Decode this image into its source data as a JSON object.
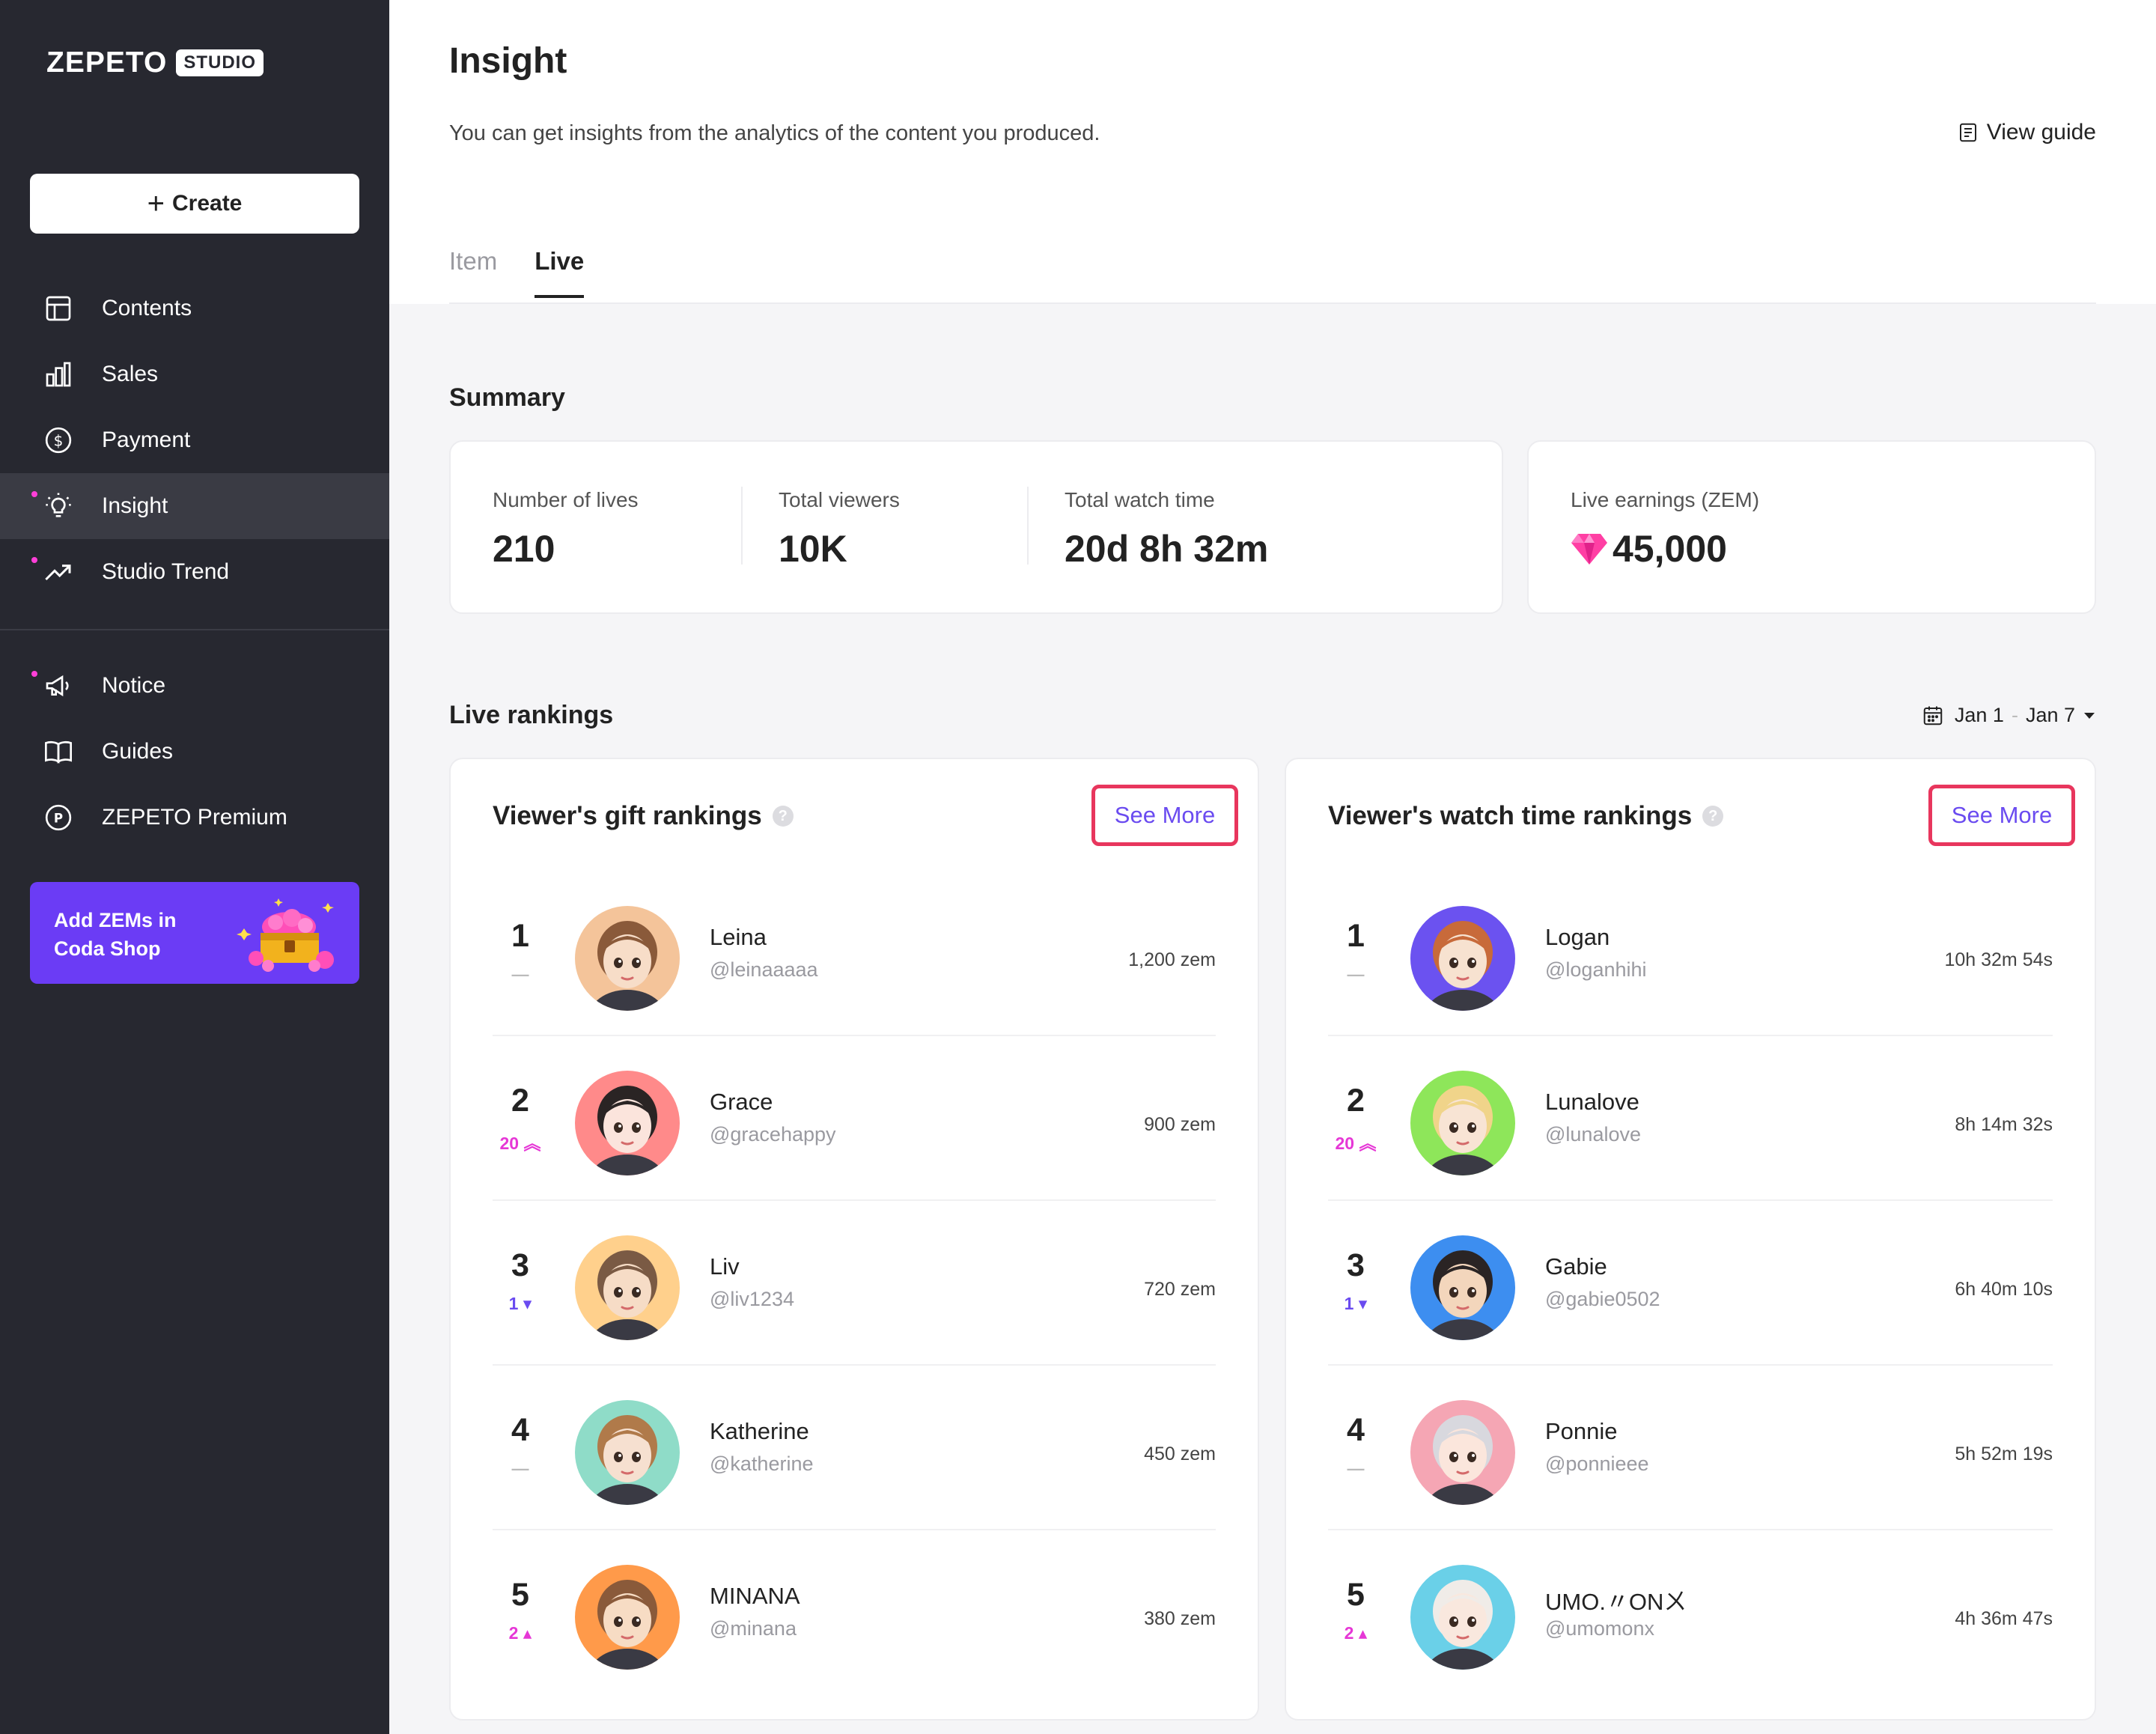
{
  "sidebar": {
    "logo_word": "ZEPETO",
    "logo_badge": "STUDIO",
    "create_label": "Create",
    "nav": [
      {
        "label": "Contents",
        "icon": "layout-icon"
      },
      {
        "label": "Sales",
        "icon": "bar-chart-icon"
      },
      {
        "label": "Payment",
        "icon": "dollar-circle-icon"
      },
      {
        "label": "Insight",
        "icon": "lightbulb-icon"
      },
      {
        "label": "Studio Trend",
        "icon": "trend-icon"
      }
    ],
    "nav2": [
      {
        "label": "Notice",
        "icon": "megaphone-icon"
      },
      {
        "label": "Guides",
        "icon": "book-icon"
      },
      {
        "label": "ZEPETO Premium",
        "icon": "premium-icon"
      }
    ],
    "promo_line1": "Add ZEMs in",
    "promo_line2": "Coda Shop"
  },
  "header": {
    "title": "Insight",
    "subtitle": "You can get insights from the analytics of the content you produced.",
    "view_guide": "View guide",
    "tabs": [
      "Item",
      "Live"
    ],
    "active_tab": "Live"
  },
  "summary": {
    "title": "Summary",
    "number_of_lives_label": "Number of lives",
    "number_of_lives": "210",
    "total_viewers_label": "Total viewers",
    "total_viewers": "10K",
    "total_watch_time_label": "Total watch time",
    "total_watch_time": "20d 8h 32m",
    "live_earnings_label": "Live earnings (ZEM)",
    "live_earnings": "45,000"
  },
  "rankings": {
    "title": "Live rankings",
    "date_start": "Jan 1",
    "date_sep": "-",
    "date_end": "Jan 7",
    "see_more": "See More",
    "gift": {
      "title": "Viewer's gift rankings",
      "rows": [
        {
          "rank": "1",
          "change": "—",
          "dir": "same",
          "name": "Leina",
          "handle": "@leinaaaaa",
          "value": "1,200 zem"
        },
        {
          "rank": "2",
          "change": "20",
          "dir": "up-double",
          "name": "Grace",
          "handle": "@gracehappy",
          "value": "900 zem"
        },
        {
          "rank": "3",
          "change": "1",
          "dir": "down",
          "name": "Liv",
          "handle": "@liv1234",
          "value": "720 zem"
        },
        {
          "rank": "4",
          "change": "—",
          "dir": "same",
          "name": "Katherine",
          "handle": "@katherine",
          "value": "450 zem"
        },
        {
          "rank": "5",
          "change": "2",
          "dir": "up",
          "name": "MINANA",
          "handle": "@minana",
          "value": "380 zem"
        }
      ]
    },
    "watch": {
      "title": "Viewer's watch time rankings",
      "rows": [
        {
          "rank": "1",
          "change": "—",
          "dir": "same",
          "name": "Logan",
          "handle": "@loganhihi",
          "value": "10h 32m 54s"
        },
        {
          "rank": "2",
          "change": "20",
          "dir": "up-double",
          "name": "Lunalove",
          "handle": "@lunalove",
          "value": "8h 14m 32s"
        },
        {
          "rank": "3",
          "change": "1",
          "dir": "down",
          "name": "Gabie",
          "handle": "@gabie0502",
          "value": "6h 40m 10s"
        },
        {
          "rank": "4",
          "change": "—",
          "dir": "same",
          "name": "Ponnie",
          "handle": "@ponnieee",
          "value": "5h 52m 19s"
        },
        {
          "rank": "5",
          "change": "2",
          "dir": "up",
          "name": "UMO.〃ONㄨ",
          "handle": "@umomonx",
          "value": "4h 36m 47s"
        }
      ]
    }
  },
  "colors": {
    "sidebar_bg": "#272830",
    "accent_purple": "#6b3cf5",
    "see_more_highlight": "#e8365d",
    "rank_up": "#e637d6",
    "rank_down": "#6a4bf0",
    "gem": "#ff3fa4"
  }
}
